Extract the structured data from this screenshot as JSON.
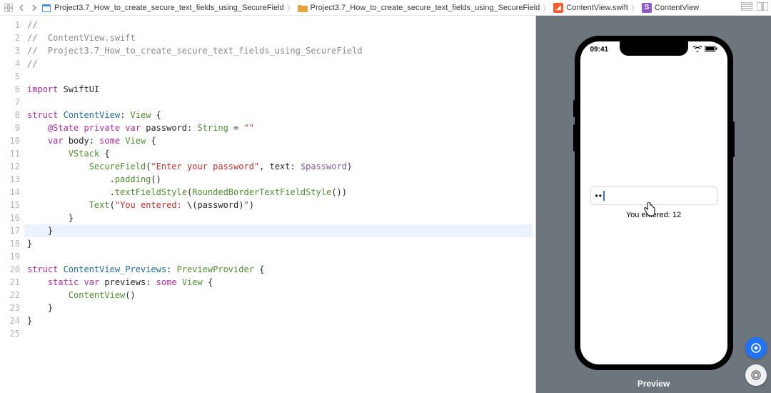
{
  "breadcrumb": {
    "project": "Project3.7_How_to_create_secure_text_fields_using_SecureField",
    "folder": "Project3.7_How_to_create_secure_text_fields_using_SecureField",
    "file": "ContentView.swift",
    "symbol": "ContentView"
  },
  "code": {
    "lines": [
      {
        "n": 1,
        "tokens": [
          [
            "//",
            "c-comment"
          ]
        ]
      },
      {
        "n": 2,
        "tokens": [
          [
            "//  ContentView.swift",
            "c-comment"
          ]
        ]
      },
      {
        "n": 3,
        "tokens": [
          [
            "//  Project3.7_How_to_create_secure_text_fields_using_SecureField",
            "c-comment"
          ]
        ]
      },
      {
        "n": 4,
        "tokens": [
          [
            "//",
            "c-comment"
          ]
        ]
      },
      {
        "n": 5,
        "tokens": [
          [
            "",
            "c-plain"
          ]
        ]
      },
      {
        "n": 6,
        "tokens": [
          [
            "import",
            "c-key"
          ],
          [
            " ",
            "c-plain"
          ],
          [
            "SwiftUI",
            "c-plain"
          ]
        ]
      },
      {
        "n": 7,
        "tokens": [
          [
            "",
            "c-plain"
          ]
        ]
      },
      {
        "n": 8,
        "tokens": [
          [
            "struct",
            "c-key"
          ],
          [
            " ",
            "c-plain"
          ],
          [
            "ContentView",
            "c-typedef"
          ],
          [
            ": ",
            "c-plain"
          ],
          [
            "View",
            "c-type"
          ],
          [
            " {",
            "c-plain"
          ]
        ]
      },
      {
        "n": 9,
        "tokens": [
          [
            "    ",
            "c-plain"
          ],
          [
            "@State",
            "c-key"
          ],
          [
            " ",
            "c-plain"
          ],
          [
            "private",
            "c-key"
          ],
          [
            " ",
            "c-plain"
          ],
          [
            "var",
            "c-key"
          ],
          [
            " password: ",
            "c-plain"
          ],
          [
            "String",
            "c-type"
          ],
          [
            " = ",
            "c-plain"
          ],
          [
            "\"\"",
            "c-str"
          ]
        ]
      },
      {
        "n": 10,
        "tokens": [
          [
            "    ",
            "c-plain"
          ],
          [
            "var",
            "c-key"
          ],
          [
            " body: ",
            "c-plain"
          ],
          [
            "some",
            "c-key"
          ],
          [
            " ",
            "c-plain"
          ],
          [
            "View",
            "c-type"
          ],
          [
            " {",
            "c-plain"
          ]
        ]
      },
      {
        "n": 11,
        "tokens": [
          [
            "        ",
            "c-plain"
          ],
          [
            "VStack",
            "c-type"
          ],
          [
            " {",
            "c-plain"
          ]
        ]
      },
      {
        "n": 12,
        "tokens": [
          [
            "            ",
            "c-plain"
          ],
          [
            "SecureField",
            "c-type"
          ],
          [
            "(",
            "c-plain"
          ],
          [
            "\"Enter your password\"",
            "c-str"
          ],
          [
            ", text: ",
            "c-plain"
          ],
          [
            "$password",
            "c-prop"
          ],
          [
            ")",
            "c-plain"
          ]
        ]
      },
      {
        "n": 13,
        "tokens": [
          [
            "                .",
            "c-plain"
          ],
          [
            "padding",
            "c-type"
          ],
          [
            "()",
            "c-plain"
          ]
        ]
      },
      {
        "n": 14,
        "tokens": [
          [
            "                .",
            "c-plain"
          ],
          [
            "textFieldStyle",
            "c-type"
          ],
          [
            "(",
            "c-plain"
          ],
          [
            "RoundedBorderTextFieldStyle",
            "c-type"
          ],
          [
            "())",
            "c-plain"
          ]
        ]
      },
      {
        "n": 15,
        "tokens": [
          [
            "            ",
            "c-plain"
          ],
          [
            "Text",
            "c-type"
          ],
          [
            "(",
            "c-plain"
          ],
          [
            "\"You entered: ",
            "c-str"
          ],
          [
            "\\(",
            "c-plain"
          ],
          [
            "password",
            "c-plain"
          ],
          [
            ")",
            "c-plain"
          ],
          [
            "\"",
            "c-str"
          ],
          [
            ")",
            "c-plain"
          ]
        ]
      },
      {
        "n": 16,
        "tokens": [
          [
            "        }",
            "c-plain"
          ]
        ]
      },
      {
        "n": 17,
        "tokens": [
          [
            "    }",
            "c-plain"
          ]
        ],
        "highlight": true
      },
      {
        "n": 18,
        "tokens": [
          [
            "}",
            "c-plain"
          ]
        ]
      },
      {
        "n": 19,
        "tokens": [
          [
            "",
            "c-plain"
          ]
        ]
      },
      {
        "n": 20,
        "tokens": [
          [
            "struct",
            "c-key"
          ],
          [
            " ",
            "c-plain"
          ],
          [
            "ContentView_Previews",
            "c-typedef"
          ],
          [
            ": ",
            "c-plain"
          ],
          [
            "PreviewProvider",
            "c-type"
          ],
          [
            " {",
            "c-plain"
          ]
        ]
      },
      {
        "n": 21,
        "tokens": [
          [
            "    ",
            "c-plain"
          ],
          [
            "static",
            "c-key"
          ],
          [
            " ",
            "c-plain"
          ],
          [
            "var",
            "c-key"
          ],
          [
            " previews: ",
            "c-plain"
          ],
          [
            "some",
            "c-key"
          ],
          [
            " ",
            "c-plain"
          ],
          [
            "View",
            "c-type"
          ],
          [
            " {",
            "c-plain"
          ]
        ]
      },
      {
        "n": 22,
        "tokens": [
          [
            "        ",
            "c-plain"
          ],
          [
            "ContentView",
            "c-type"
          ],
          [
            "()",
            "c-plain"
          ]
        ]
      },
      {
        "n": 23,
        "tokens": [
          [
            "    }",
            "c-plain"
          ]
        ]
      },
      {
        "n": 24,
        "tokens": [
          [
            "}",
            "c-plain"
          ]
        ]
      },
      {
        "n": 25,
        "tokens": [
          [
            "",
            "c-plain"
          ]
        ]
      }
    ]
  },
  "preview": {
    "label": "Preview",
    "statusTime": "09:41",
    "secureDots": "••",
    "entered": "You entered: 12"
  }
}
